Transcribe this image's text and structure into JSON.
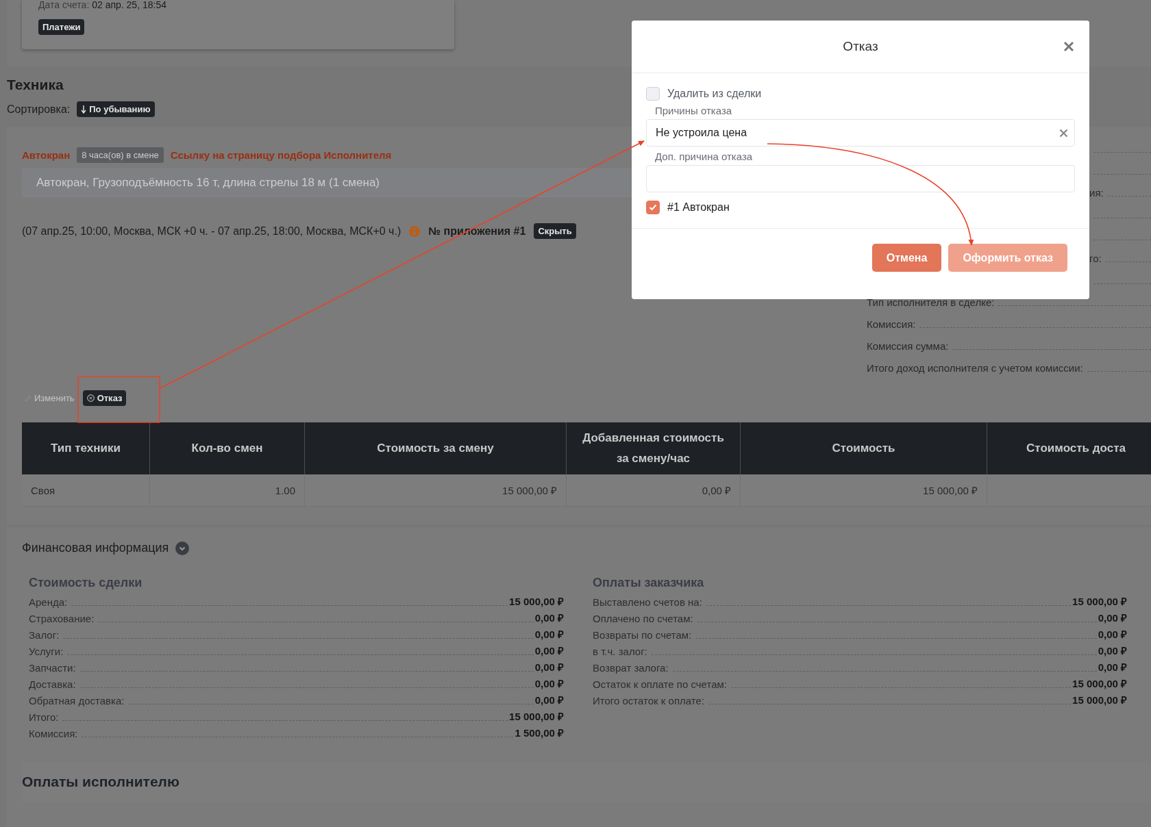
{
  "invoice_card": {
    "date_label": "Дата счета:",
    "date_value": "02 апр. 25, 18:54",
    "payments_button": "Платежи"
  },
  "equipment": {
    "title": "Техника",
    "sort_label": "Сортировка:",
    "sort_button": "По убыванию",
    "item": {
      "name": "Автокран",
      "shift_badge": "8 часа(ов) в смене",
      "link": "Ссылку на страницу подбора Исполнителя",
      "description": "Автокран, Грузоподъёмность 16 т, длина стрелы 18 м (1 смена)",
      "period": "(07 апр.25, 10:00, Москва, МСК +0 ч. - 07 апр.25, 18:00, Москва, МСК+0 ч.)",
      "appendix": "№ приложения #1",
      "hide_button": "Скрыть",
      "actions": [
        {
          "kind": "edit",
          "label": "Изменить",
          "disabled": true
        },
        {
          "kind": "reject",
          "label": "Отказ",
          "disabled": false
        }
      ]
    },
    "details": [
      {
        "covered": true
      },
      {
        "covered": true
      },
      {
        "label": "ия:",
        "covered": true
      },
      {
        "covered": true
      },
      {
        "covered": true
      },
      {
        "label": "го:",
        "covered": true
      },
      {
        "covered": true
      },
      {
        "label": "Тип исполнителя в сделке:",
        "covered": false
      },
      {
        "label": "Комиссия:",
        "covered": false
      },
      {
        "label": "Комиссия сумма:",
        "covered": false
      },
      {
        "label": "Итого доход исполнителя с учетом комиссии:",
        "covered": false
      }
    ],
    "table": {
      "columns": [
        "Тип техники",
        "Кол-во смен",
        "Стоимость за смену",
        "Добавленная стоимость за смену/час",
        "Стоимость",
        "Стоимость доста"
      ],
      "rows": [
        [
          "Своя",
          "1.00",
          "15 000,00 ₽",
          "0,00 ₽",
          "15 000,00 ₽",
          ""
        ]
      ]
    }
  },
  "finance": {
    "title": "Финансовая информация",
    "expanded": true,
    "sections": [
      {
        "title": "Стоимость сделки",
        "rows": [
          {
            "label": "Аренда:",
            "value": "15 000,00 ₽"
          },
          {
            "label": "Страхование:",
            "value": "0,00 ₽"
          },
          {
            "label": "Залог:",
            "value": "0,00 ₽"
          },
          {
            "label": "Услуги:",
            "value": "0,00 ₽"
          },
          {
            "label": "Запчасти:",
            "value": "0,00 ₽"
          },
          {
            "label": "Доставка:",
            "value": "0,00 ₽"
          },
          {
            "label": "Обратная доставка:",
            "value": "0,00 ₽"
          },
          {
            "label": "Итого:",
            "value": "15 000,00 ₽"
          },
          {
            "label": "Комиссия:",
            "value": "1 500,00 ₽"
          }
        ]
      },
      {
        "title": "Оплаты заказчика",
        "rows": [
          {
            "label": "Выставлено счетов на:",
            "value": "15 000,00 ₽"
          },
          {
            "label": "Оплачено по счетам:",
            "value": "0,00 ₽"
          },
          {
            "label": "Возвраты по счетам:",
            "value": "0,00 ₽"
          },
          {
            "label": "в т.ч. залог:",
            "value": "0,00 ₽"
          },
          {
            "label": "Возврат залога:",
            "value": "0,00 ₽"
          },
          {
            "label": "Остаток к оплате по счетам:",
            "value": "15 000,00 ₽"
          },
          {
            "label": "Итого остаток к оплате:",
            "value": "15 000,00 ₽"
          }
        ]
      }
    ],
    "executor_payments": "Оплаты исполнителю"
  },
  "modal": {
    "title": "Отказ",
    "remove_from_deal": {
      "label": "Удалить из сделки",
      "checked": false
    },
    "reasons_label": "Причины отказа",
    "reason_value": "Не устроила цена",
    "extra_label": "Доп. причина отказа",
    "items": [
      {
        "label": "#1 Автокран",
        "checked": true
      }
    ],
    "buttons": [
      {
        "label": "Отмена",
        "disabled": false
      },
      {
        "label": "Оформить отказ",
        "disabled": true
      }
    ]
  }
}
